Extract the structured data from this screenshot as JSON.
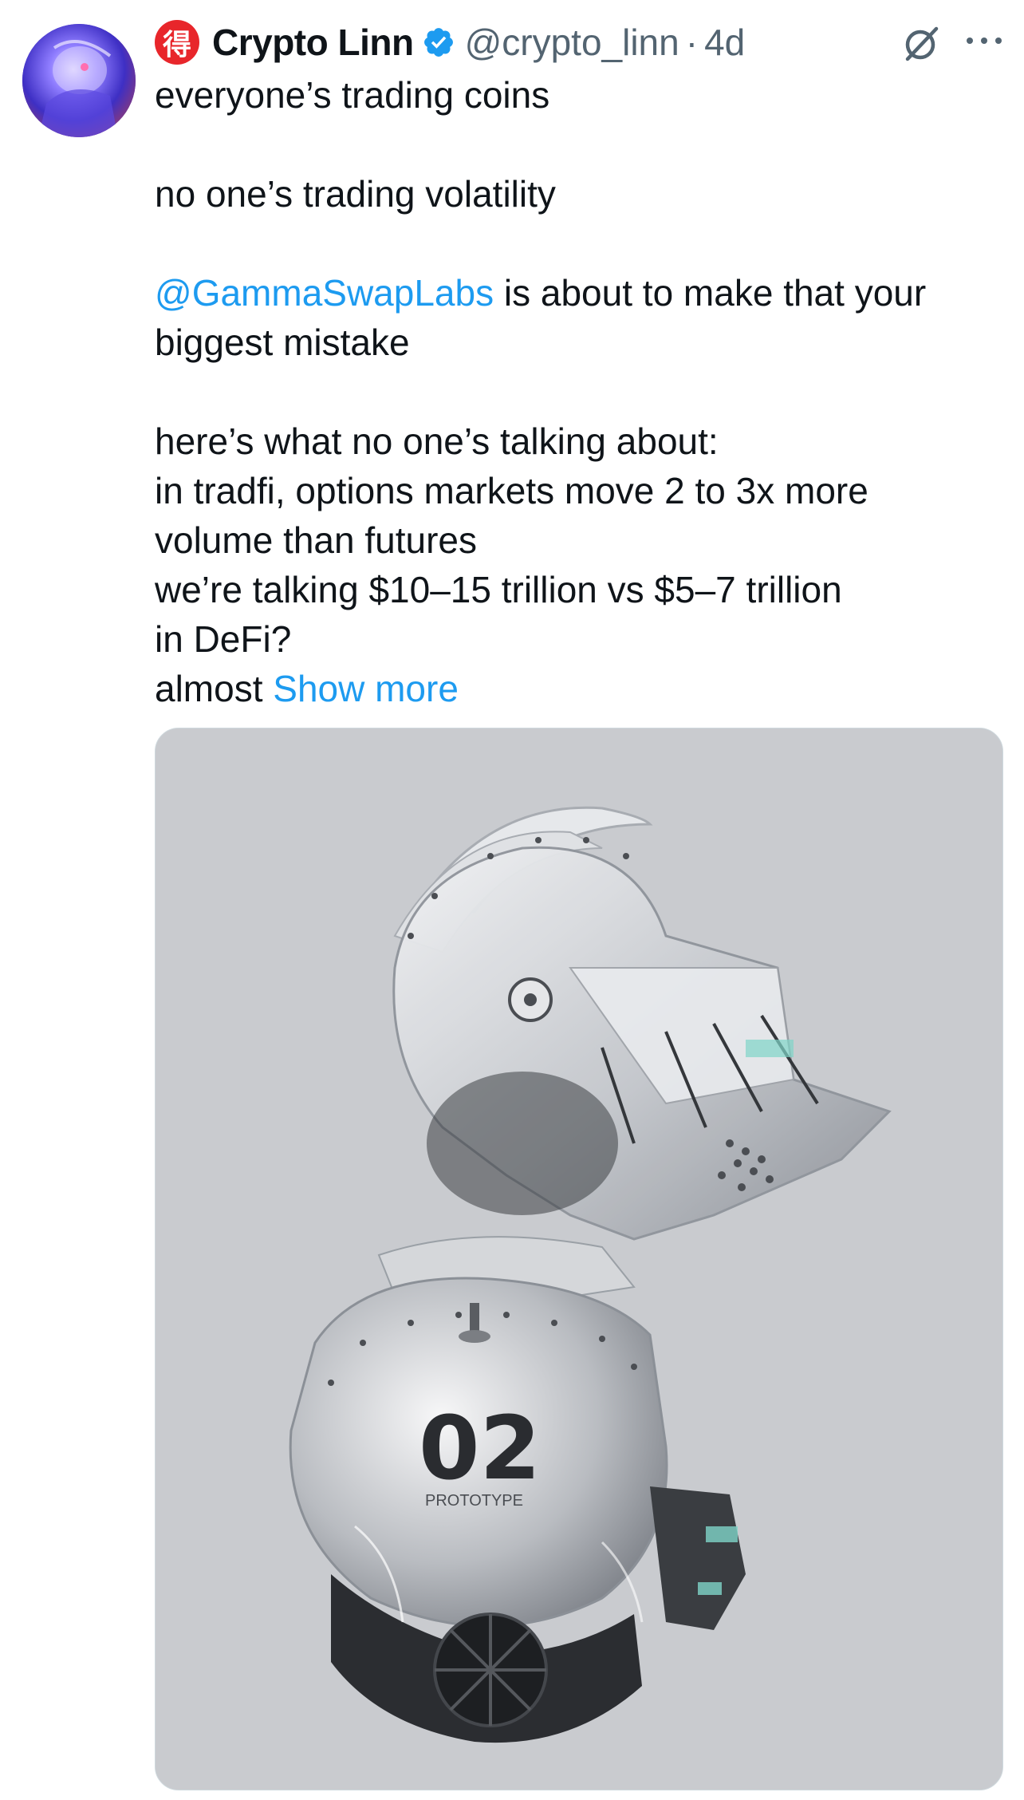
{
  "author": {
    "badge_glyph": "得",
    "display_name": "Crypto Linn",
    "handle": "@crypto_linn",
    "separator": "·",
    "timestamp": "4d",
    "verified": true,
    "badge_color": "#e8262b",
    "verified_color": "#1d9bf0"
  },
  "actions": {
    "grok_icon": "grok-icon",
    "more_icon": "more-icon"
  },
  "post": {
    "line1": "everyone’s trading coins",
    "line2": "no one’s trading volatility",
    "mention": "@GammaSwapLabs",
    "line3_rest": " is about to make that your",
    "line4": "biggest mistake",
    "line5": "here’s what no one’s talking about:",
    "line6": "in tradfi, options markets move 2 to 3x more",
    "line7": "volume than futures",
    "line8": "we’re talking $10–15 trillion vs $5–7 trillion",
    "line9": "in DeFi?",
    "line10_prefix": "almost ",
    "show_more": "Show more",
    "link_color": "#1d9bf0"
  },
  "media": {
    "helmet_number": "02",
    "helmet_label": "PROTOTYPE",
    "background_color": "#c9cbcf"
  }
}
